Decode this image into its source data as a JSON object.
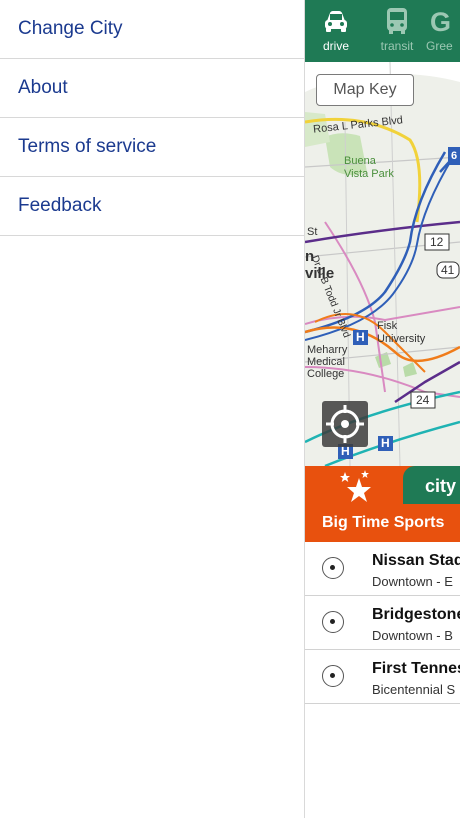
{
  "menu": {
    "items": [
      {
        "label": "Change City"
      },
      {
        "label": "About"
      },
      {
        "label": "Terms of service"
      },
      {
        "label": "Feedback"
      }
    ]
  },
  "modes": [
    {
      "label": "drive",
      "icon": "car-icon",
      "active": true
    },
    {
      "label": "transit",
      "icon": "bus-icon",
      "active": false
    },
    {
      "label": "Gree",
      "icon": "green-g-icon",
      "active": false
    }
  ],
  "map": {
    "key_label": "Map Key",
    "labels": {
      "rosa": "Rosa L Parks Blvd",
      "buena": "Buena",
      "vista": "Vista Park",
      "st": "St",
      "dbtodd": "Dr D B Todd Jr Blvd",
      "n": "n",
      "ville": "ville",
      "fisk": "Fisk",
      "university": "University",
      "meharry": "Meharry",
      "medical": "Medical",
      "college": "College",
      "hospital": "H",
      "hospital2": "H",
      "hospital3": "H",
      "route12": "12",
      "route41": "41",
      "route24": "24",
      "route6": "6"
    }
  },
  "banner": {
    "tab_label": "city",
    "title": "Big Time Sports"
  },
  "venues": [
    {
      "name": "Nissan Stad",
      "sub": "Downtown - E"
    },
    {
      "name": "Bridgestone",
      "sub": "Downtown - B"
    },
    {
      "name": "First Tennes",
      "sub": "Bicentennial S"
    }
  ],
  "colors": {
    "menu_text": "#1b3a8f",
    "modebar": "#1f7a55",
    "banner": "#e8510e"
  }
}
